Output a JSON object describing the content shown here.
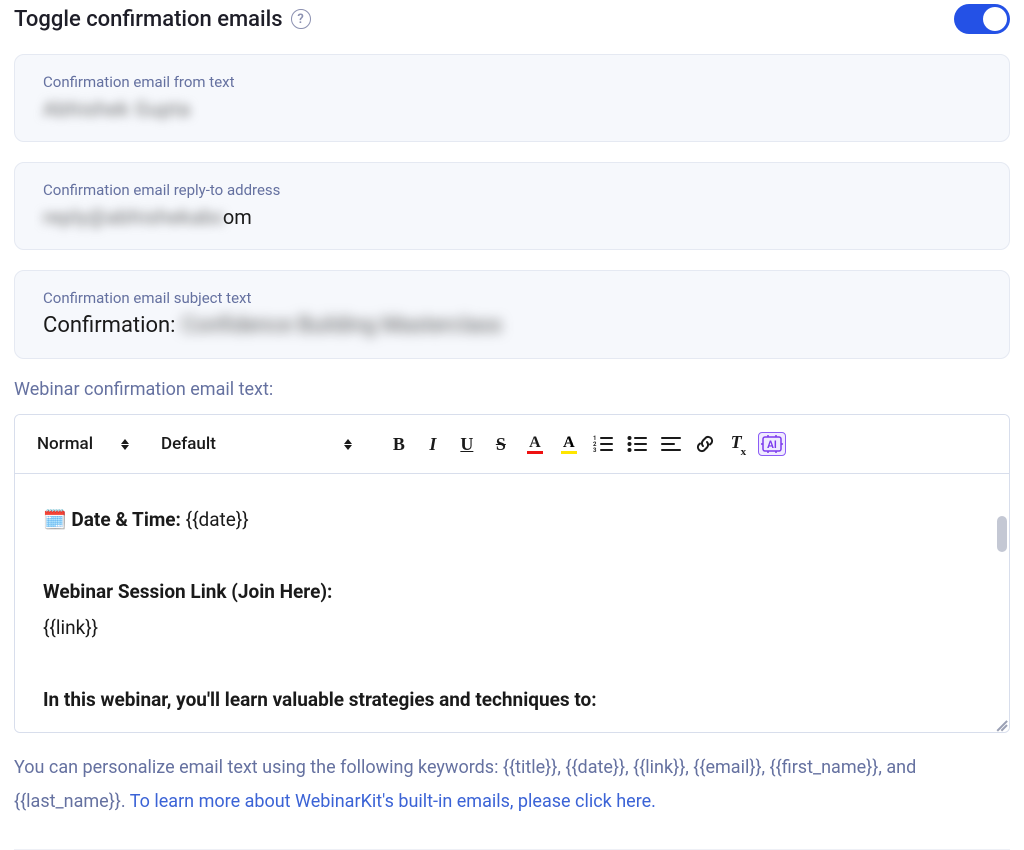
{
  "toggle": {
    "label": "Toggle confirmation emails",
    "on": true
  },
  "fields": {
    "from": {
      "label": "Confirmation email from text",
      "value_redacted": "Abhishek Gupta"
    },
    "reply_to": {
      "label": "Confirmation email reply-to address",
      "value_redacted": "reply@abhishekabc",
      "visible_suffix": "om"
    },
    "subject": {
      "label": "Confirmation email subject text",
      "prefix": "Confirmation:",
      "value_redacted": "Confidence Building Masterclass"
    }
  },
  "body_section_label": "Webinar confirmation email text:",
  "toolbar": {
    "heading_select": "Normal",
    "font_select": "Default",
    "buttons": {
      "bold": "B",
      "italic": "I",
      "underline": "U",
      "strike": "S",
      "text_color": "A",
      "highlight": "A",
      "ordered_list": "ol",
      "bullet_list": "ul",
      "align": "align",
      "link": "link",
      "clear_format": "Tx",
      "ai": "AI"
    }
  },
  "editor": {
    "line1_icon": "🗓️",
    "line1_label": "Date & Time:",
    "line1_value": "{{date}}",
    "line2_heading": "Webinar Session Link (Join Here):",
    "line2_value": "{{link}}",
    "line3_heading": "In this webinar, you'll learn valuable strategies and techniques to:"
  },
  "hint": {
    "text_prefix": "You can personalize email text using the following keywords: {{title}}, {{date}}, {{link}}, {{email}}, {{first_name}}, and {{last_name}}. ",
    "link_text": "To learn more about WebinarKit's built-in emails, please click here."
  }
}
